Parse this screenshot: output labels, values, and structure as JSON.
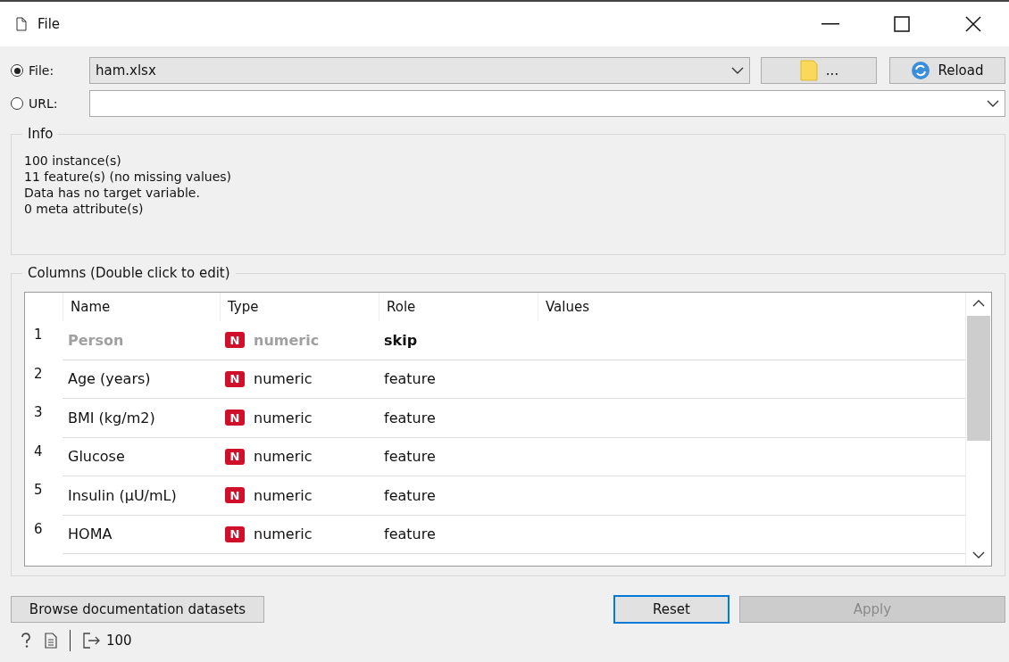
{
  "window": {
    "title": "File"
  },
  "source": [
    {
      "kind": "file",
      "label": "File:",
      "selected": true,
      "value": "ham.xlsx"
    },
    {
      "kind": "url",
      "label": "URL:",
      "selected": false
    }
  ],
  "browse_button": {
    "label": "..."
  },
  "reload_button": {
    "label": "Reload"
  },
  "info": {
    "title": "Info",
    "lines": [
      "100 instance(s)",
      "11 feature(s) (no missing values)",
      "Data has no target variable.",
      "0 meta attribute(s)"
    ]
  },
  "columns_box": {
    "title": "Columns (Double click to edit)",
    "table": {
      "columns": [
        "Name",
        "Type",
        "Role",
        "Values"
      ],
      "rows": [
        {
          "index": "1",
          "name": "Person",
          "type_badge": "N",
          "type": "numeric",
          "role": "skip",
          "skipped": true
        },
        {
          "index": "2",
          "name": "Age (years)",
          "type_badge": "N",
          "type": "numeric",
          "role": "feature",
          "skipped": false
        },
        {
          "index": "3",
          "name": "BMI (kg/m2)",
          "type_badge": "N",
          "type": "numeric",
          "role": "feature",
          "skipped": false
        },
        {
          "index": "4",
          "name": "Glucose",
          "type_badge": "N",
          "type": "numeric",
          "role": "feature",
          "skipped": false
        },
        {
          "index": "5",
          "name": "Insulin (µU/mL)",
          "type_badge": "N",
          "type": "numeric",
          "role": "feature",
          "skipped": false
        },
        {
          "index": "6",
          "name": "HOMA",
          "type_badge": "N",
          "type": "numeric",
          "role": "feature",
          "skipped": false
        }
      ]
    }
  },
  "buttons": [
    {
      "label": "Browse documentation datasets",
      "disabled": false,
      "focused": false
    },
    {
      "label": "Reset",
      "disabled": false,
      "focused": true
    },
    {
      "label": "Apply",
      "disabled": true,
      "focused": false
    }
  ],
  "status_bar": {
    "output_count": "100"
  }
}
